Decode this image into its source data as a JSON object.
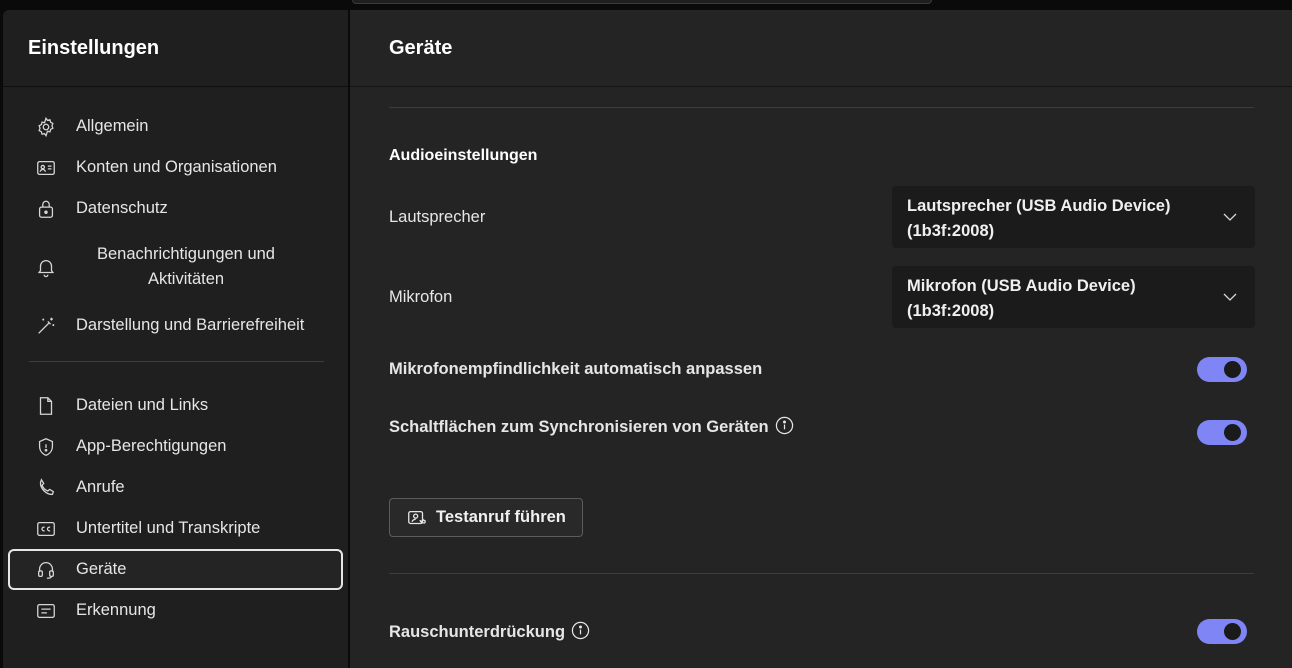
{
  "sidebar": {
    "title": "Einstellungen",
    "items_top": [
      {
        "label": "Allgemein",
        "icon": "gear-icon"
      },
      {
        "label": "Konten und Organisationen",
        "icon": "id-card-icon"
      },
      {
        "label": "Datenschutz",
        "icon": "lock-icon"
      },
      {
        "label": "Benachrichtigungen und Aktivitäten",
        "icon": "bell-icon"
      },
      {
        "label": "Darstellung und Barrierefreiheit",
        "icon": "magic-wand-icon"
      }
    ],
    "items_bottom": [
      {
        "label": "Dateien und Links",
        "icon": "document-icon"
      },
      {
        "label": "App-Berechtigungen",
        "icon": "shield-icon"
      },
      {
        "label": "Anrufe",
        "icon": "phone-icon"
      },
      {
        "label": "Untertitel und Transkripte",
        "icon": "closed-caption-icon"
      },
      {
        "label": "Geräte",
        "icon": "headset-icon",
        "active": true
      },
      {
        "label": "Erkennung",
        "icon": "text-box-icon"
      }
    ]
  },
  "main": {
    "title": "Geräte",
    "audio_section_title": "Audioeinstellungen",
    "speaker": {
      "label": "Lautsprecher",
      "value_line1": "Lautsprecher (USB Audio Device)",
      "value_line2": "(1b3f:2008)"
    },
    "microphone": {
      "label": "Mikrofon",
      "value_line1": "Mikrofon (USB Audio Device)",
      "value_line2": "(1b3f:2008)"
    },
    "auto_adjust": {
      "label": "Mikrofonempfindlichkeit automatisch anpassen",
      "enabled": true
    },
    "sync_buttons": {
      "label": "Schaltflächen zum Synchronisieren von Geräten",
      "enabled": true
    },
    "test_call_label": "Testanruf führen",
    "noise_suppression": {
      "label": "Rauschunterdrückung",
      "enabled": true
    }
  },
  "colors": {
    "toggle_on": "#7f85f5",
    "sidebar_bg": "#1f1f1f",
    "main_bg": "#242424"
  }
}
